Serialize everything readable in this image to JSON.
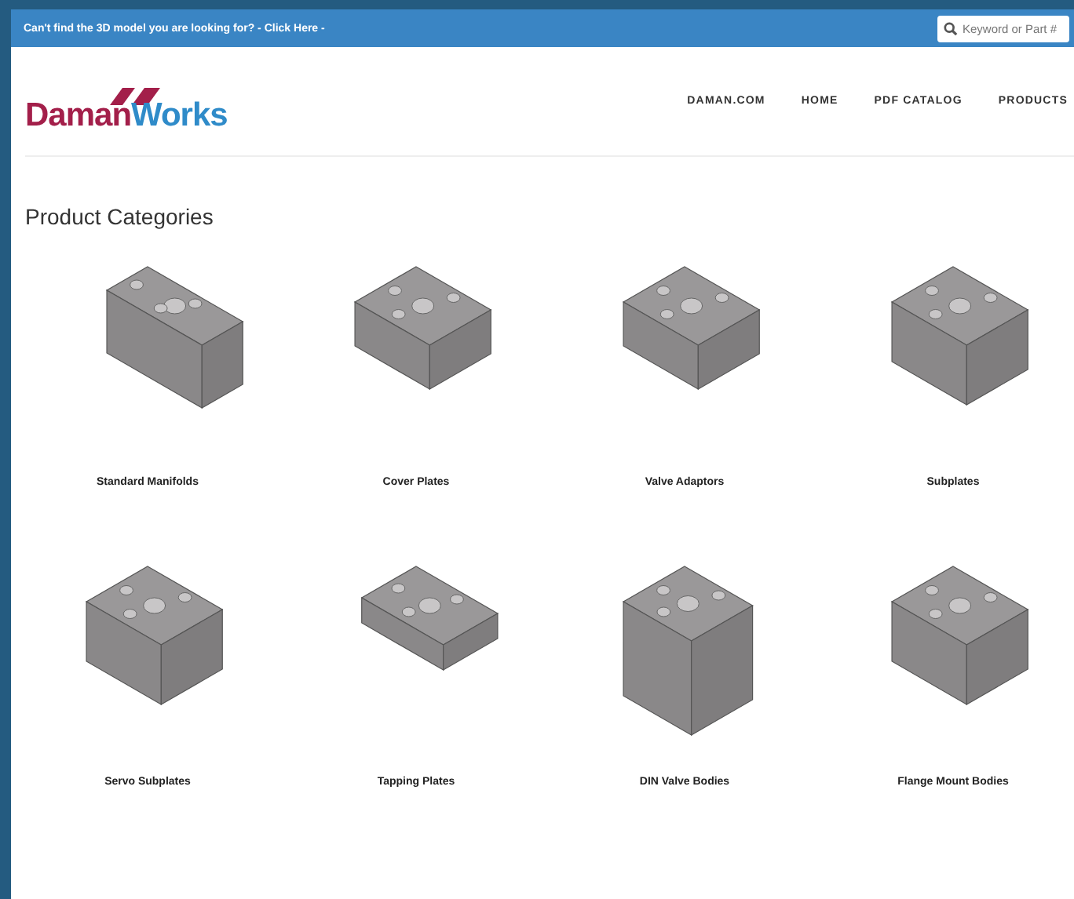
{
  "top_bar": {
    "message": "Can't find the 3D model you are looking for? - Click Here -",
    "search": {
      "placeholder": "Keyword or Part #"
    }
  },
  "logo": {
    "first": "Daman",
    "second": "Works"
  },
  "nav": [
    {
      "label": "DAMAN.COM"
    },
    {
      "label": "HOME"
    },
    {
      "label": "PDF CATALOG"
    },
    {
      "label": "PRODUCTS"
    }
  ],
  "heading": "Product Categories",
  "categories": [
    {
      "label": "Standard Manifolds"
    },
    {
      "label": "Cover Plates"
    },
    {
      "label": "Valve Adaptors"
    },
    {
      "label": "Subplates"
    },
    {
      "label": "Servo Subplates"
    },
    {
      "label": "Tapping Plates"
    },
    {
      "label": "DIN Valve Bodies"
    },
    {
      "label": "Flange Mount Bodies"
    }
  ]
}
